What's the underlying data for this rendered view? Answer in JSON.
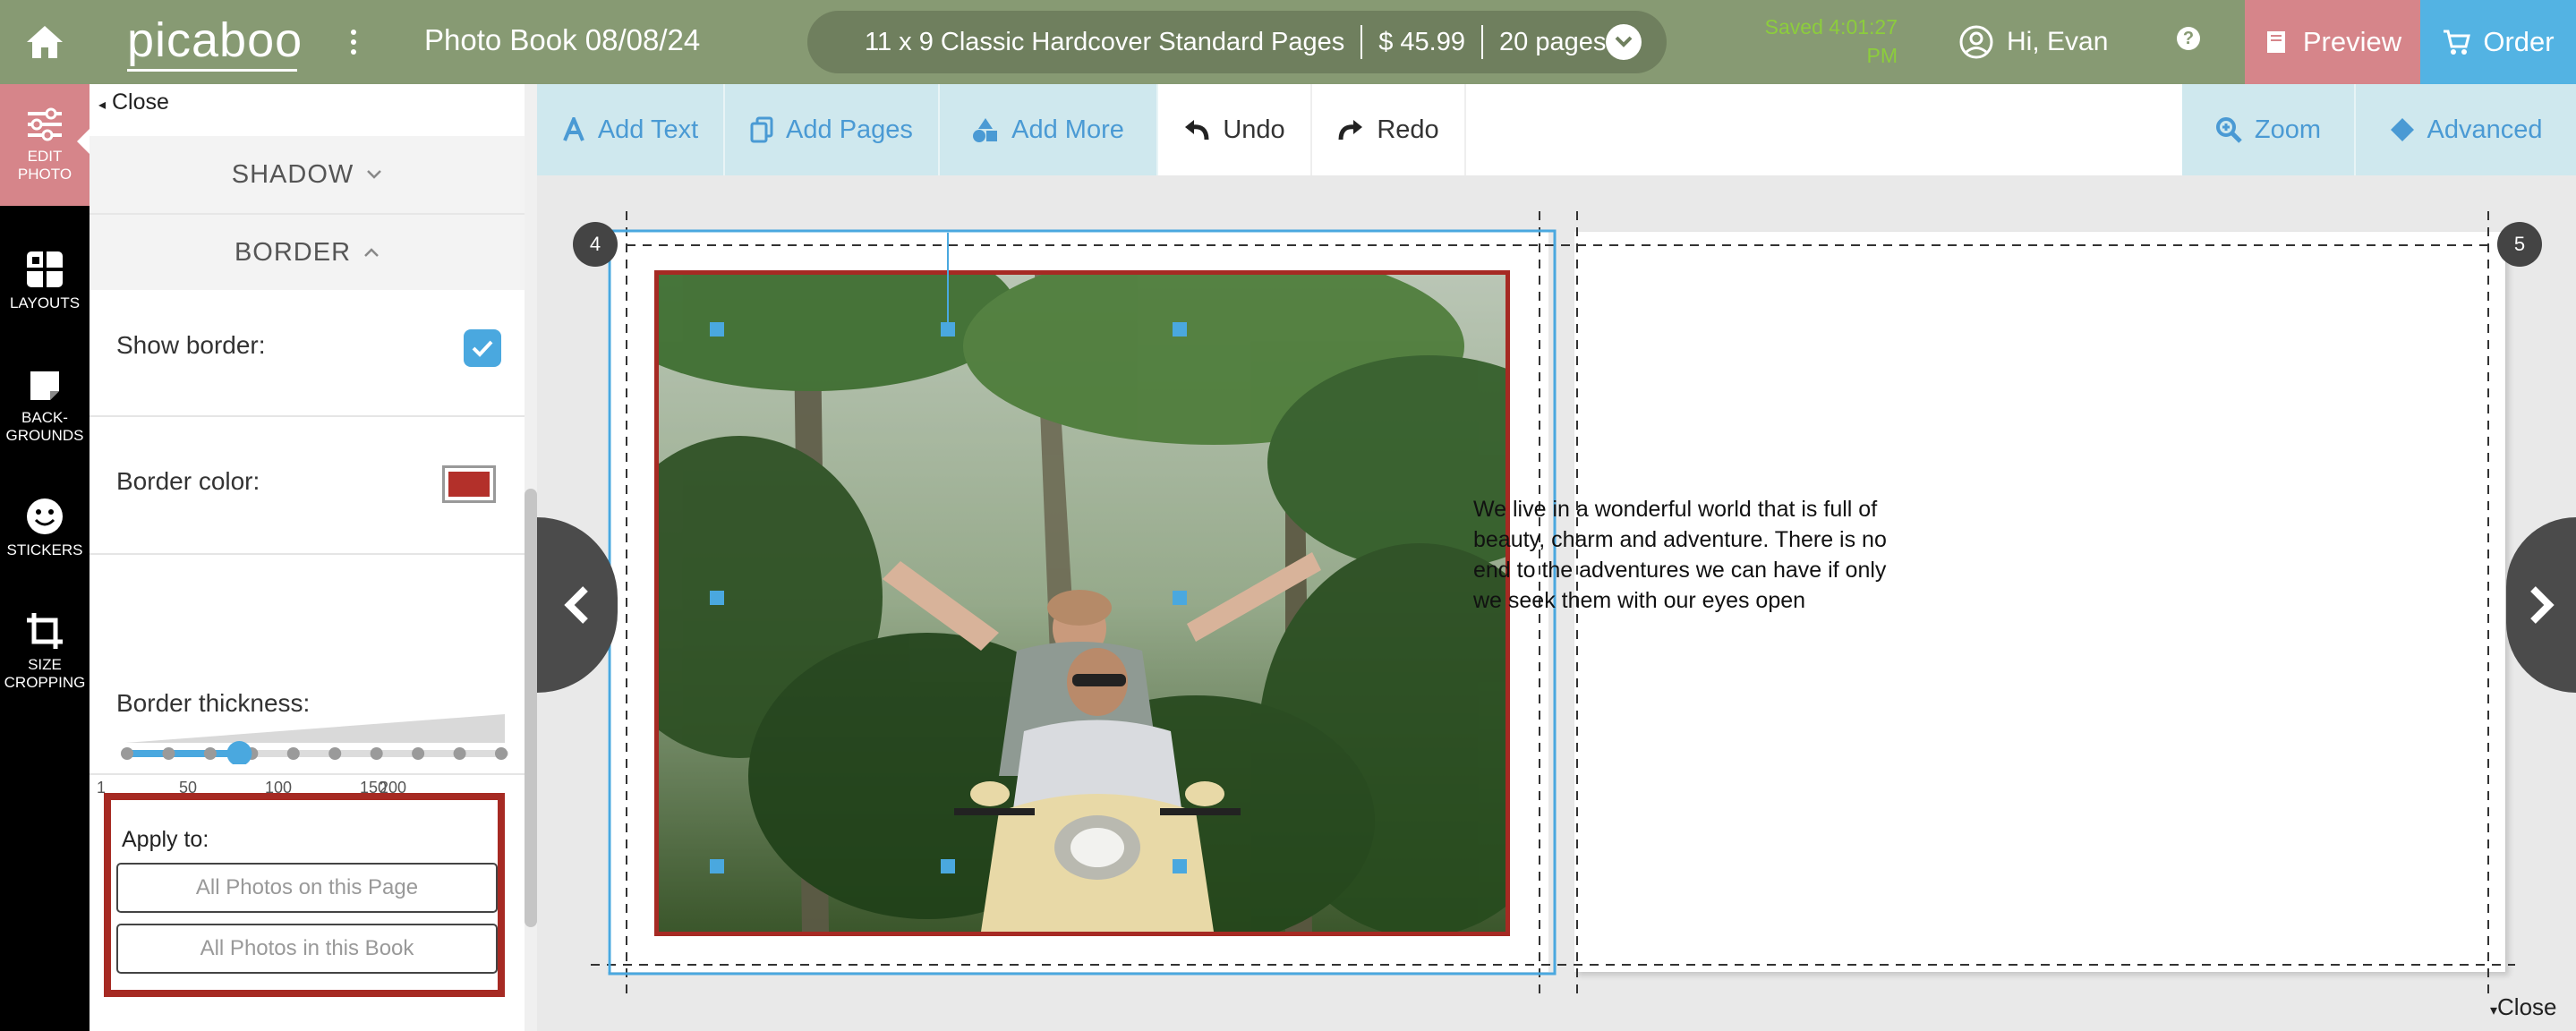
{
  "header": {
    "logo_text": "picaboo",
    "doc_title": "Photo Book 08/08/24",
    "product": "11 x 9 Classic Hardcover Standard Pages",
    "price": "$ 45.99",
    "pages": "20 pages",
    "saved_line1": "Saved 4:01:27",
    "saved_line2": "PM",
    "greeting": "Hi, Evan",
    "help": "?",
    "preview_label": "Preview",
    "order_label": "Order"
  },
  "rail": [
    {
      "label": "EDIT PHOTO",
      "icon": "sliders-icon"
    },
    {
      "label": "LAYOUTS",
      "icon": "layouts-icon"
    },
    {
      "label": "BACK-GROUNDS",
      "icon": "backgrounds-icon"
    },
    {
      "label": "STICKERS",
      "icon": "smiley-icon"
    },
    {
      "label": "SIZE CROPPING",
      "icon": "crop-icon"
    }
  ],
  "panel": {
    "close": "Close",
    "shadow": "SHADOW",
    "border": "BORDER",
    "show_border": "Show border:",
    "show_border_checked": true,
    "border_color_label": "Border color:",
    "border_color": "#b3302a",
    "thickness_label": "Border thickness:",
    "thickness_ticks": [
      "1",
      "50",
      "100",
      "150",
      "200"
    ],
    "thickness_value_fraction": 0.3,
    "apply_to": "Apply to:",
    "apply_page": "All Photos on this Page",
    "apply_book": "All Photos in this Book"
  },
  "toolbar": {
    "add_text": "Add Text",
    "add_pages": "Add Pages",
    "add_more": "Add More",
    "undo": "Undo",
    "redo": "Redo",
    "zoom": "Zoom",
    "advanced": "Advanced"
  },
  "canvas": {
    "left_page_num": "4",
    "right_page_num": "5",
    "story_text": "We live in a wonderful world that is full of beauty, charm and adventure. There is no end to the adventures we can have if only we seek them with our eyes open",
    "close": "Close"
  },
  "colors": {
    "header": "#879a73",
    "preview": "#d6858a",
    "order": "#53b3e3",
    "accent_blue": "#4aa8df",
    "border_red": "#a62a23"
  }
}
